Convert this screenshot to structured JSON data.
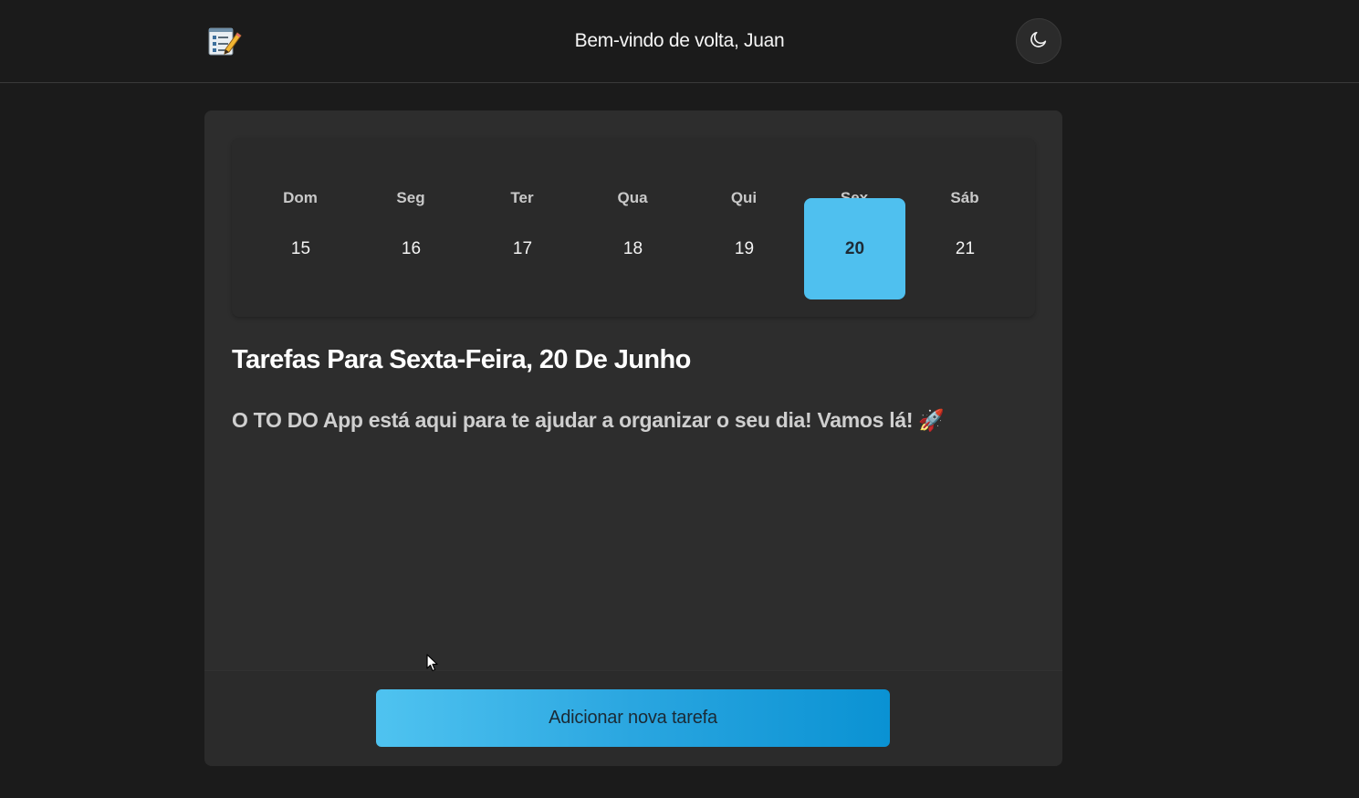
{
  "header": {
    "logo_icon": "checklist-notepad-icon",
    "welcome_text": "Bem-vindo de volta, Juan",
    "theme_toggle_icon": "moon-icon"
  },
  "calendar": {
    "weekdays": [
      "Dom",
      "Seg",
      "Ter",
      "Qua",
      "Qui",
      "Sex",
      "Sáb"
    ],
    "days": [
      "15",
      "16",
      "17",
      "18",
      "19",
      "20",
      "21"
    ],
    "selected_day": "20",
    "accent_color": "#4fc0ef"
  },
  "tasks": {
    "title": "Tarefas Para Sexta-Feira, 20 De Junho",
    "empty_message": "O TO DO App está aqui para te ajudar a organizar o seu dia! Vamos lá! 🚀"
  },
  "actions": {
    "add_task_label": "Adicionar nova tarefa"
  },
  "colors": {
    "background": "#1b1b1b",
    "card": "#2d2d2d",
    "button_gradient_start": "#4fc3f0",
    "button_gradient_end": "#0a92d3"
  }
}
